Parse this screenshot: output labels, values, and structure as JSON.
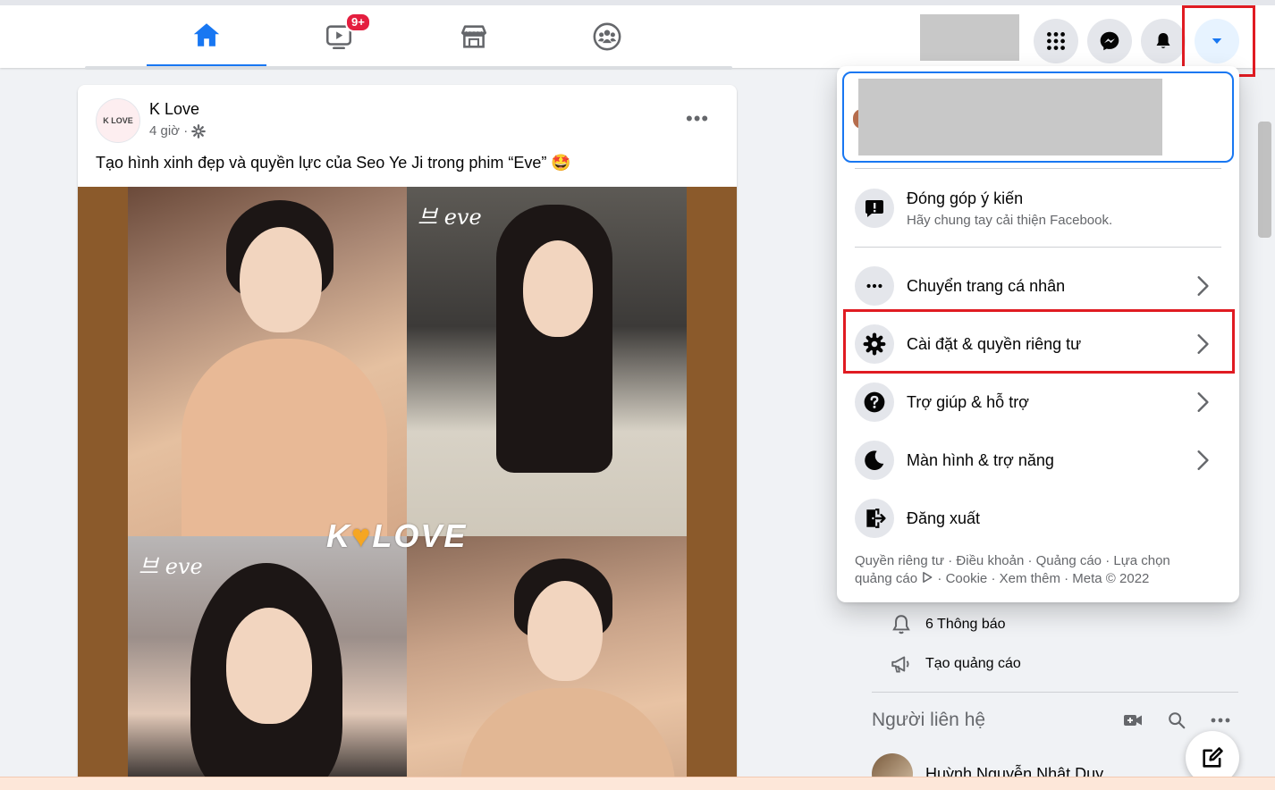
{
  "nav": {
    "tabs": [
      {
        "name": "home",
        "icon": "home-icon",
        "active": true
      },
      {
        "name": "watch",
        "icon": "video-icon",
        "badge": "9+"
      },
      {
        "name": "marketplace",
        "icon": "store-icon"
      },
      {
        "name": "groups",
        "icon": "groups-icon"
      }
    ],
    "accent_color": "#1877f2",
    "right_buttons": [
      "menu-grid-icon",
      "messenger-icon",
      "bell-icon",
      "caret-down-icon"
    ]
  },
  "post": {
    "author": "K Love",
    "avatar_text": "K LOVE",
    "time": "4 giờ ·",
    "more": "•••",
    "caption": "Tạo hình xinh đẹp và quyền lực của Seo Ye Ji trong phim “Eve” 🤩",
    "image_watermark": {
      "left": "K",
      "heart": "♥",
      "right": "LOVE"
    },
    "show_logo": "브 eve"
  },
  "menu": {
    "items": [
      {
        "label": "Đóng góp ý kiến",
        "sub": "Hãy chung tay cải thiện Facebook.",
        "icon": "feedback-icon"
      },
      {
        "label": "Chuyển trang cá nhân",
        "icon": "more-dots-icon",
        "chevron": true
      },
      {
        "label": "Cài đặt & quyền riêng tư",
        "icon": "settings-gear-icon",
        "chevron": true
      },
      {
        "label": "Trợ giúp & hỗ trợ",
        "icon": "help-icon",
        "chevron": true
      },
      {
        "label": "Màn hình & trợ năng",
        "icon": "moon-icon",
        "chevron": true
      },
      {
        "label": "Đăng xuất",
        "icon": "logout-icon"
      }
    ],
    "footer_line1": "Quyền riêng tư · Điều khoản · Quảng cáo · Lựa chọn",
    "footer_line2_a": "quảng cáo",
    "footer_line2_b": "· Cookie · Xem thêm · Meta © 2022"
  },
  "right_column": {
    "notifications": "6 Thông báo",
    "create_ad": "Tạo quảng cáo",
    "contacts_title": "Người liên hệ",
    "contact_name": "Huỳnh Nguyễn Nhật Duy"
  },
  "highlight_color": "#e01b22"
}
